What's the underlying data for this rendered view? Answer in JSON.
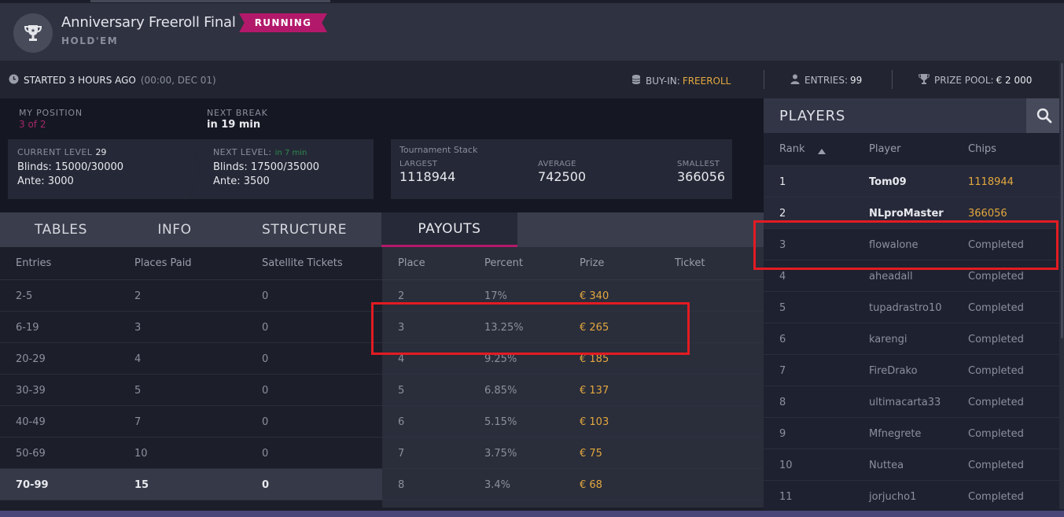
{
  "header": {
    "title": "Anniversary Freeroll Final",
    "game": "HOLD'EM",
    "status": "RUNNING"
  },
  "infobar": {
    "started": "STARTED 3 HOURS AGO",
    "started_time": "(00:00, DEC 01)",
    "buyin_label": "BUY-IN:",
    "buyin_value": "FREEROLL",
    "entries_label": "ENTRIES:",
    "entries_value": "99",
    "prize_label": "PRIZE POOL:",
    "prize_value": "€ 2 000"
  },
  "position": {
    "label": "MY POSITION",
    "value": "3 of 2"
  },
  "next_break": {
    "label": "NEXT BREAK",
    "value": "in 19 min"
  },
  "levels": {
    "current_label": "CURRENT LEVEL",
    "current_num": "29",
    "current_blinds": "Blinds: 15000/30000",
    "current_ante": "Ante: 3000",
    "next_label": "NEXT LEVEL:",
    "next_in": "in 7 min",
    "next_blinds": "Blinds: 17500/35000",
    "next_ante": "Ante: 3500"
  },
  "stack": {
    "caption": "Tournament Stack",
    "largest_label": "LARGEST",
    "largest": "1118944",
    "average_label": "AVERAGE",
    "average": "742500",
    "smallest_label": "SMALLEST",
    "smallest": "366056"
  },
  "tabs": [
    "TABLES",
    "INFO",
    "STRUCTURE",
    "PAYOUTS"
  ],
  "entries_table": {
    "headers": [
      "Entries",
      "Places Paid",
      "Satellite Tickets"
    ],
    "rows": [
      [
        "2-5",
        "2",
        "0"
      ],
      [
        "6-19",
        "3",
        "0"
      ],
      [
        "20-29",
        "4",
        "0"
      ],
      [
        "30-39",
        "5",
        "0"
      ],
      [
        "40-49",
        "7",
        "0"
      ],
      [
        "50-69",
        "10",
        "0"
      ],
      [
        "70-99",
        "15",
        "0"
      ]
    ]
  },
  "payouts_table": {
    "headers": [
      "Place",
      "Percent",
      "Prize",
      "Ticket"
    ],
    "rows": [
      [
        "2",
        "17%",
        "€ 340"
      ],
      [
        "3",
        "13.25%",
        "€ 265"
      ],
      [
        "4",
        "9.25%",
        "€ 185"
      ],
      [
        "5",
        "6.85%",
        "€ 137"
      ],
      [
        "6",
        "5.15%",
        "€ 103"
      ],
      [
        "7",
        "3.75%",
        "€ 75"
      ],
      [
        "8",
        "3.4%",
        "€ 68"
      ]
    ]
  },
  "players": {
    "title": "PLAYERS",
    "headers": [
      "Rank",
      "Player",
      "Chips"
    ],
    "rows": [
      [
        "1",
        "Tom09",
        "1118944"
      ],
      [
        "2",
        "NLproMaster",
        "366056"
      ],
      [
        "3",
        "flowalone",
        "Completed"
      ],
      [
        "4",
        "aheadall",
        "Completed"
      ],
      [
        "5",
        "tupadrastro10",
        "Completed"
      ],
      [
        "6",
        "karengi",
        "Completed"
      ],
      [
        "7",
        "FireDrako",
        "Completed"
      ],
      [
        "8",
        "ultimacarta33",
        "Completed"
      ],
      [
        "9",
        "Mfnegrete",
        "Completed"
      ],
      [
        "10",
        "Nuttea",
        "Completed"
      ],
      [
        "11",
        "jorjucho1",
        "Completed"
      ]
    ]
  },
  "colors": {
    "accent": "#b3196a",
    "gold": "#e3a83f",
    "highlight_box": "#e31b23",
    "next_level_green": "#2e8b4e"
  }
}
